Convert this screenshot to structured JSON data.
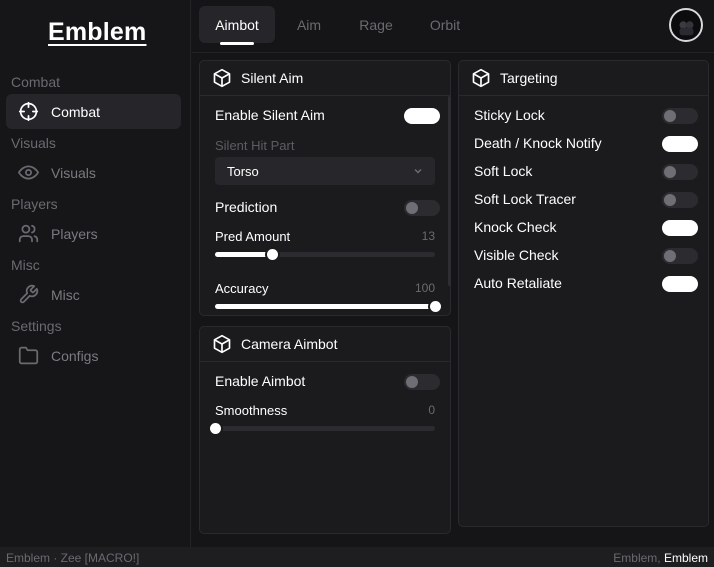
{
  "sidebar": {
    "logo": "Emblem",
    "sections": [
      {
        "label": "Combat",
        "item": "Combat",
        "icon": "crosshair-icon",
        "active": true
      },
      {
        "label": "Visuals",
        "item": "Visuals",
        "icon": "eye-icon",
        "active": false
      },
      {
        "label": "Players",
        "item": "Players",
        "icon": "users-icon",
        "active": false
      },
      {
        "label": "Misc",
        "item": "Misc",
        "icon": "wrench-icon",
        "active": false
      },
      {
        "label": "Settings",
        "item": "Configs",
        "icon": "folder-icon",
        "active": false
      }
    ]
  },
  "tabs": [
    {
      "label": "Aimbot",
      "active": true
    },
    {
      "label": "Aim",
      "active": false
    },
    {
      "label": "Rage",
      "active": false
    },
    {
      "label": "Orbit",
      "active": false
    }
  ],
  "silent_aim": {
    "title": "Silent Aim",
    "enable_label": "Enable Silent Aim",
    "enable_on": true,
    "hit_part_label": "Silent Hit Part",
    "hit_part_value": "Torso",
    "prediction_label": "Prediction",
    "prediction_on": false,
    "pred_amount_label": "Pred Amount",
    "pred_amount_value": "13",
    "pred_amount_fraction": 0.26,
    "accuracy_label": "Accuracy",
    "accuracy_value": "100",
    "accuracy_fraction": 1.0
  },
  "camera_aimbot": {
    "title": "Camera Aimbot",
    "enable_label": "Enable Aimbot",
    "enable_on": false,
    "smoothness_label": "Smoothness",
    "smoothness_value": "0",
    "smoothness_fraction": 0.0
  },
  "targeting": {
    "title": "Targeting",
    "options": [
      {
        "label": "Sticky Lock",
        "on": false
      },
      {
        "label": "Death / Knock Notify",
        "on": true
      },
      {
        "label": "Soft Lock",
        "on": false
      },
      {
        "label": "Soft Lock Tracer",
        "on": false
      },
      {
        "label": "Knock Check",
        "on": true
      },
      {
        "label": "Visible Check",
        "on": false
      },
      {
        "label": "Auto Retaliate",
        "on": true
      }
    ]
  },
  "footer": {
    "left": "Emblem · Zee [MACRO!]",
    "right_prefix": "Emblem,",
    "right_bold": "Emblem"
  },
  "colors": {
    "background": "#151517",
    "panel": "#1b1b1e",
    "accent": "#ffffff",
    "muted": "#6a6a70"
  }
}
